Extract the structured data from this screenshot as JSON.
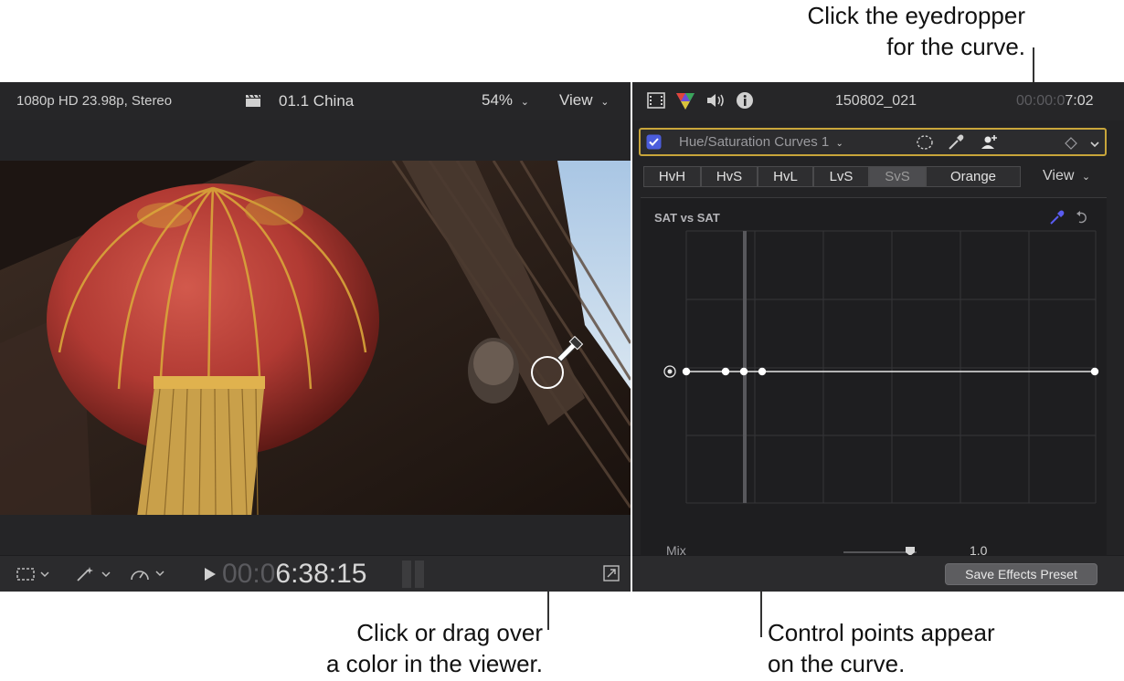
{
  "annotations": {
    "eyedropper_callout": [
      "Click the eyedropper",
      "for the curve."
    ],
    "viewer_callout": [
      "Click or drag over",
      "a color in the viewer."
    ],
    "curve_callout": [
      "Control points appear",
      "on the curve."
    ]
  },
  "viewer": {
    "format": "1080p HD 23.98p, Stereo",
    "clip_name": "01.1 China",
    "zoom": "54%",
    "view_label": "View",
    "timecode_dim": "00:0",
    "timecode_bright": "6:38:15"
  },
  "inspector": {
    "clip_name": "150802_021",
    "duration_dim": "00:00:0",
    "duration_bright": "7:02",
    "effect_name": "Hue/Saturation Curves 1",
    "tabs": [
      "HvH",
      "HvS",
      "HvL",
      "LvS",
      "SvS",
      "Orange"
    ],
    "active_tab": "SvS",
    "view_label": "View",
    "curve_title": "SAT vs SAT",
    "mix_label": "Mix",
    "mix_value": "1.0",
    "save_button": "Save Effects Preset"
  },
  "colors": {
    "accent_blue": "#5a5cf0",
    "effect_outline": "#c8a53a",
    "checkbox": "#4b5ddc"
  }
}
